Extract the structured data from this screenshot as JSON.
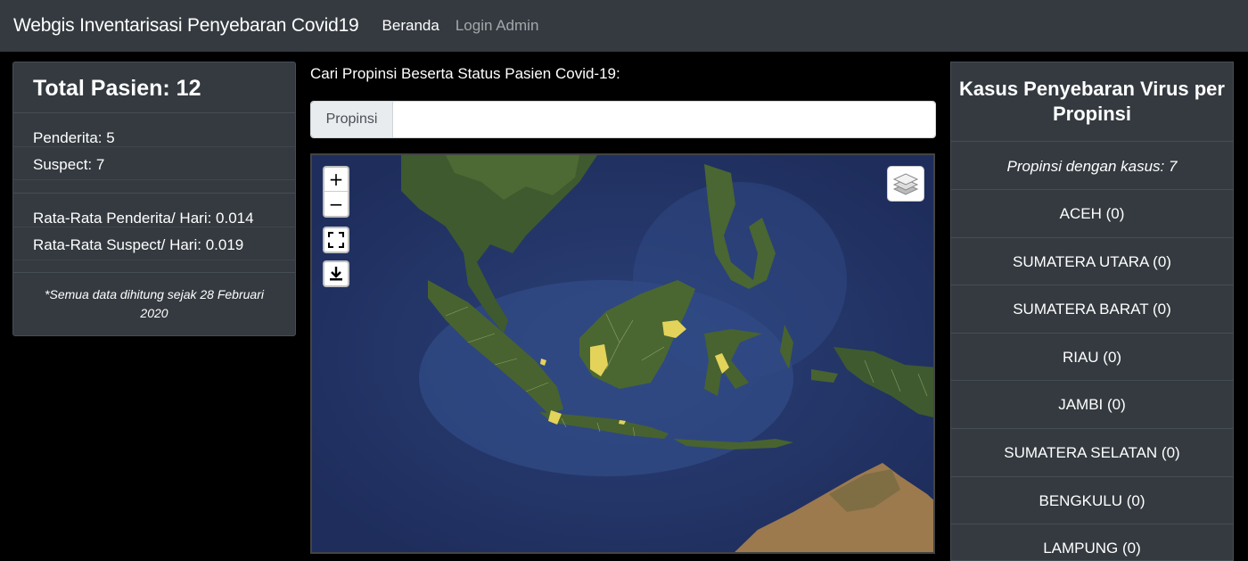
{
  "navbar": {
    "brand": "Webgis Inventarisasi Penyebaran Covid19",
    "links": [
      {
        "label": "Beranda",
        "active": true
      },
      {
        "label": "Login Admin",
        "active": false
      }
    ]
  },
  "stats": {
    "title": "Total Pasien: 12",
    "penderita": "Penderita: 5",
    "suspect": "Suspect: 7",
    "avg_penderita": "Rata-Rata Penderita/ Hari: 0.014",
    "avg_suspect": "Rata-Rata Suspect/ Hari: 0.019",
    "note": "*Semua data dihitung sejak 28 Februari 2020"
  },
  "search": {
    "label": "Cari Propinsi Beserta Status Pasien Covid-19:",
    "prefix": "Propinsi",
    "value": "",
    "placeholder": ""
  },
  "map": {
    "zoom_in": "+",
    "zoom_out": "−",
    "icons": [
      "fullscreen-icon",
      "download-icon",
      "layers-icon"
    ],
    "colors": {
      "ocean": "#26386b",
      "land": "#3f5a2e",
      "highlight": "#e3d35a"
    }
  },
  "cases": {
    "title": "Kasus Penyebaran Virus per Propinsi",
    "count_text": "Propinsi dengan kasus: 7",
    "provinces": [
      "ACEH (0)",
      "SUMATERA UTARA (0)",
      "SUMATERA BARAT (0)",
      "RIAU (0)",
      "JAMBI (0)",
      "SUMATERA SELATAN (0)",
      "BENGKULU (0)",
      "LAMPUNG (0)"
    ]
  }
}
